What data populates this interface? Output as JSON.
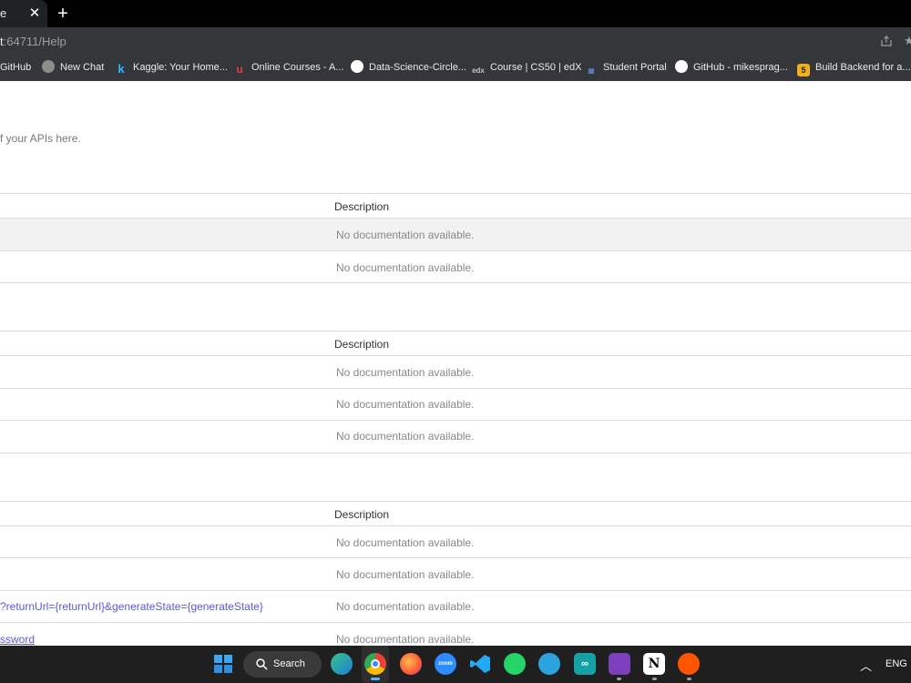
{
  "browser": {
    "tab_title_fragment": "e",
    "tab_close": "✕",
    "new_tab": "+",
    "url_host_fragment": "t",
    "url_path": ":64711/Help"
  },
  "bookmarks": [
    {
      "label": "GitHub",
      "icon": "github-icon"
    },
    {
      "label": "New Chat",
      "icon": "chatgpt-icon"
    },
    {
      "label": "Kaggle: Your Home...",
      "icon": "kaggle-icon"
    },
    {
      "label": "Online Courses - A...",
      "icon": "udemy-icon"
    },
    {
      "label": "Data-Science-Circle...",
      "icon": "github-icon"
    },
    {
      "label": "Course | CS50 | edX",
      "icon": "edx-icon"
    },
    {
      "label": "Student Portal",
      "icon": "portal-icon"
    },
    {
      "label": "GitHub - mikesprag...",
      "icon": "github-icon"
    },
    {
      "label": "Build Backend for a...",
      "icon": "bookmark-5-icon",
      "badge": "5"
    }
  ],
  "page": {
    "intro_fragment": "f your APIs here.",
    "tables": [
      {
        "description_header": "Description",
        "rows": [
          {
            "api": "",
            "description": "No documentation available."
          },
          {
            "api": "",
            "description": "No documentation available."
          }
        ]
      },
      {
        "description_header": "Description",
        "rows": [
          {
            "api": "",
            "description": "No documentation available."
          },
          {
            "api": "",
            "description": "No documentation available."
          },
          {
            "api": "",
            "description": "No documentation available."
          }
        ]
      },
      {
        "description_header": "Description",
        "rows": [
          {
            "api": "",
            "description": "No documentation available."
          },
          {
            "api": "",
            "description": "No documentation available."
          },
          {
            "api": "?returnUrl={returnUrl}&generateState={generateState}",
            "description": "No documentation available."
          },
          {
            "api": "ssword",
            "description": "No documentation available."
          }
        ]
      }
    ]
  },
  "taskbar": {
    "search_label": "Search",
    "language": "ENG",
    "apps": [
      "windows-start",
      "edge",
      "chrome",
      "firefox",
      "zoom",
      "vscode",
      "whatsapp",
      "telegram",
      "arduino",
      "visual-studio",
      "notion",
      "soundcloud"
    ],
    "zoom_label": "zoom",
    "notion_label": "N"
  },
  "colors": {
    "tab_strip": "#000000",
    "toolbar": "#35363a",
    "link": "#5a5adb",
    "taskbar": "#1f1f1f"
  }
}
